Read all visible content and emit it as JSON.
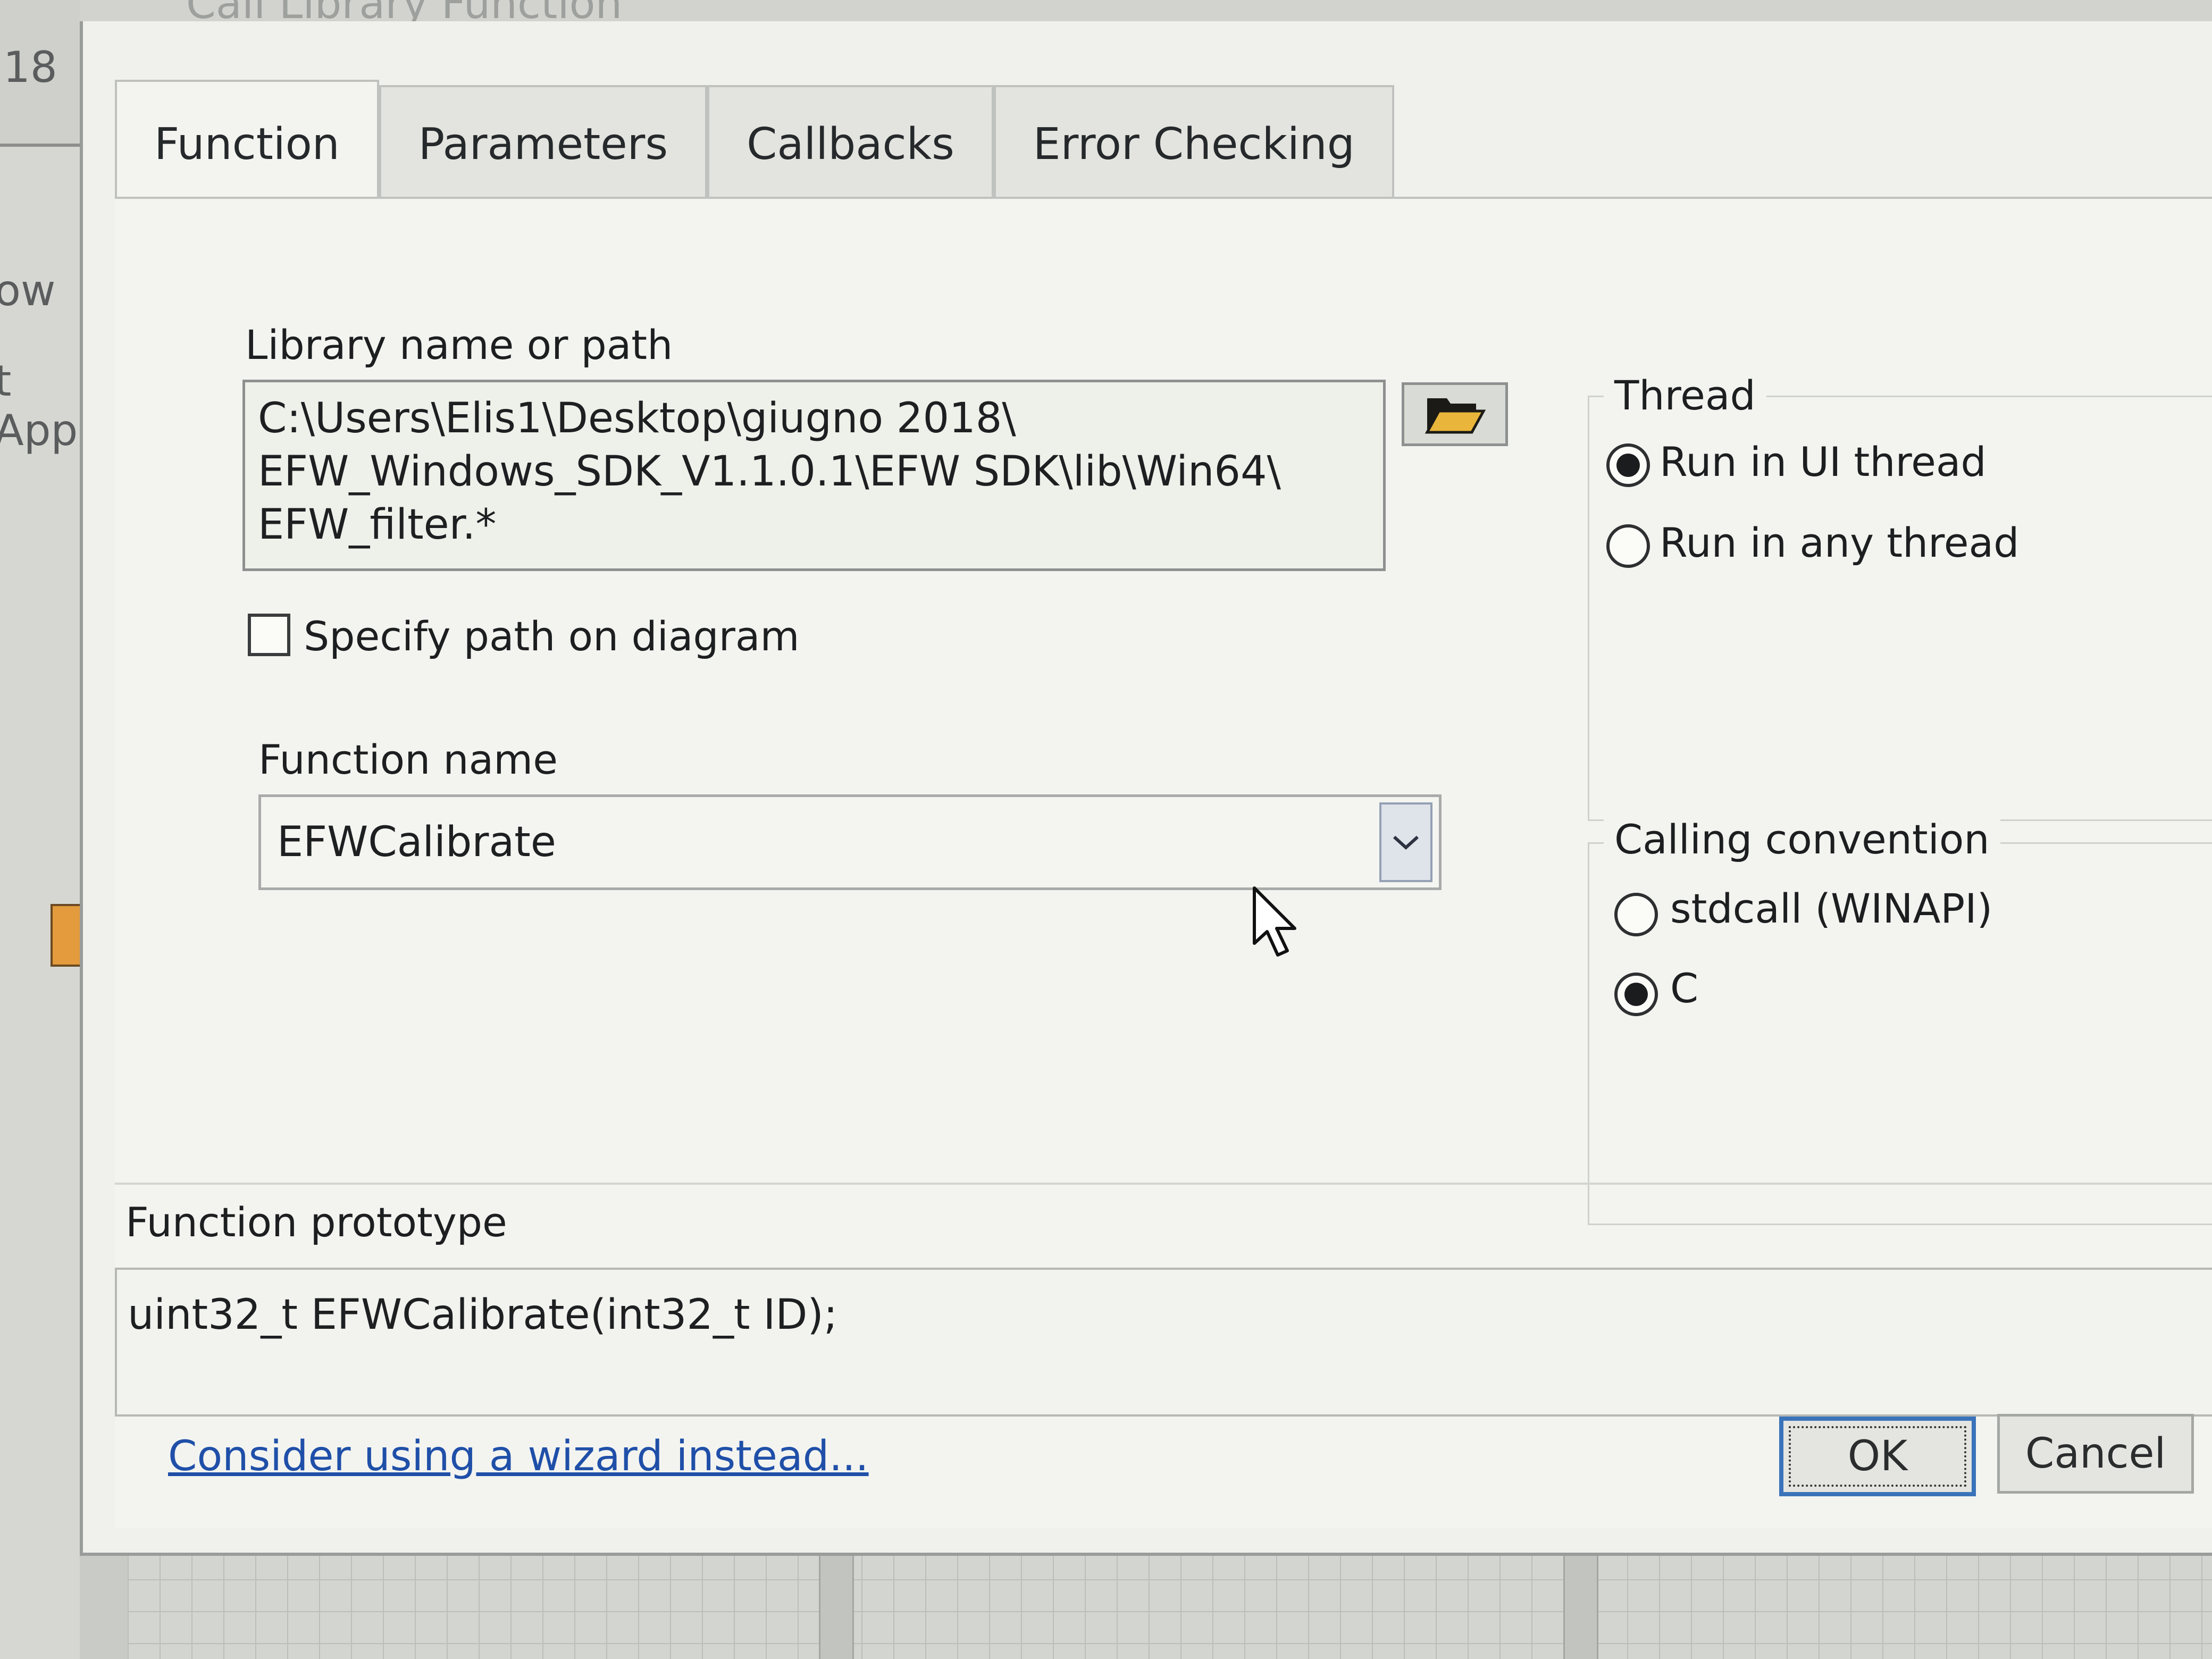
{
  "background": {
    "left_texts": [
      "18",
      "ow",
      "t App"
    ],
    "dialog_title": "Call Library Function"
  },
  "tabs": [
    {
      "label": "Function",
      "active": true
    },
    {
      "label": "Parameters",
      "active": false
    },
    {
      "label": "Callbacks",
      "active": false
    },
    {
      "label": "Error Checking",
      "active": false
    }
  ],
  "library": {
    "label": "Library name or path",
    "path_lines": [
      "C:\\Users\\Elis1\\Desktop\\giugno 2018\\",
      "EFW_Windows_SDK_V1.1.0.1\\EFW SDK\\lib\\Win64\\",
      "EFW_filter.*"
    ],
    "browse_icon": "folder-open-icon",
    "specify_path_label": "Specify path on diagram",
    "specify_path_checked": false
  },
  "function": {
    "label": "Function name",
    "value": "EFWCalibrate"
  },
  "thread": {
    "label": "Thread",
    "options": [
      {
        "label": "Run in UI thread",
        "selected": true
      },
      {
        "label": "Run in any thread",
        "selected": false
      }
    ]
  },
  "calling_convention": {
    "label": "Calling convention",
    "options": [
      {
        "label": "stdcall (WINAPI)",
        "selected": false
      },
      {
        "label": "C",
        "selected": true
      }
    ]
  },
  "prototype": {
    "label": "Function prototype",
    "value": "uint32_t EFWCalibrate(int32_t ID);"
  },
  "footer": {
    "wizard_link": "Consider using a wizard instead...",
    "ok_label": "OK",
    "cancel_label": "Cancel"
  },
  "colors": {
    "link": "#1f4fa8",
    "default_button_border": "#3a73b9",
    "dialog_bg": "#f0f1ed"
  }
}
